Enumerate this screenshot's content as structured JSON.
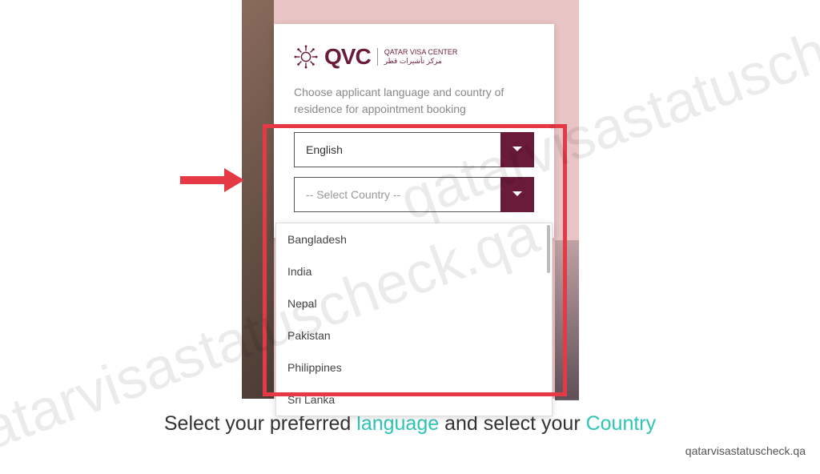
{
  "watermark": "qatarvisastatuscheck.qa",
  "logo": {
    "text": "QVC",
    "sub_en": "QATAR VISA CENTER",
    "sub_ar": "مركز تأشيرات قطر"
  },
  "instruction": "Choose applicant language and country of residence for appointment booking",
  "language_select": {
    "value": "English"
  },
  "country_select": {
    "placeholder": "-- Select Country --",
    "options": [
      "Bangladesh",
      "India",
      "Nepal",
      "Pakistan",
      "Philippines",
      "Sri Lanka"
    ]
  },
  "caption": {
    "part1": "Select your preferred ",
    "highlight1": "language",
    "part2": " and select your ",
    "highlight2": "Country"
  },
  "credit": "qatarvisastatuscheck.qa"
}
